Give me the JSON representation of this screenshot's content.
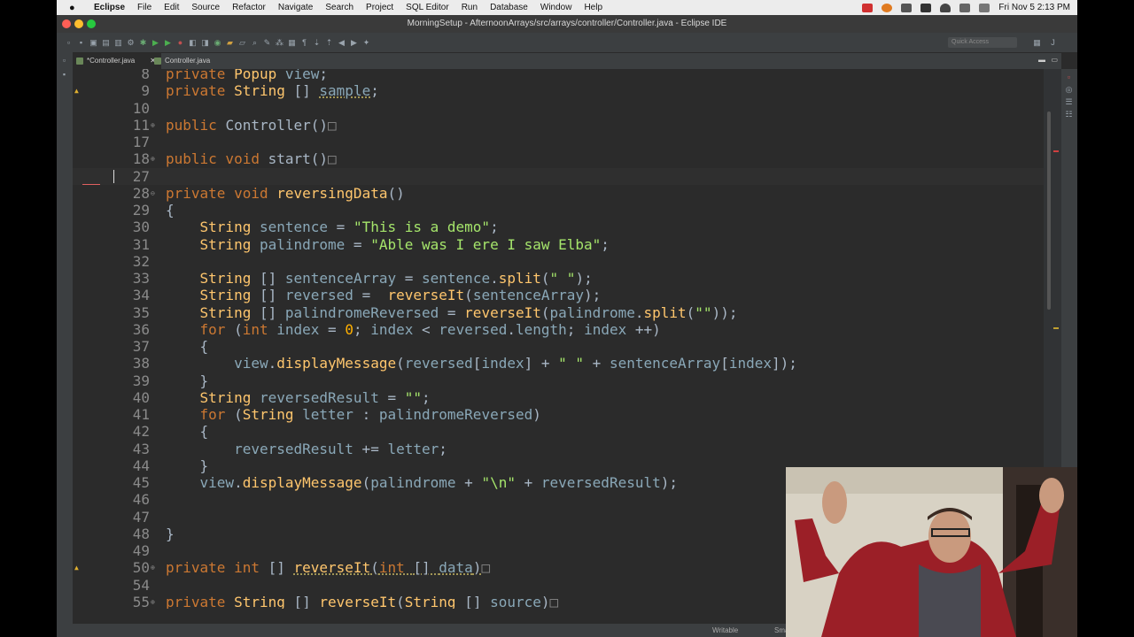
{
  "menubar": {
    "app": "Eclipse",
    "items": [
      "File",
      "Edit",
      "Source",
      "Refactor",
      "Navigate",
      "Search",
      "Project",
      "SQL Editor",
      "Run",
      "Database",
      "Window",
      "Help"
    ],
    "clock": "Fri Nov 5  2:13 PM"
  },
  "window": {
    "title": "MorningSetup - AfternoonArrays/src/arrays/controller/Controller.java - Eclipse IDE"
  },
  "toolbar": {
    "quick_access": "Quick Access"
  },
  "tabs": [
    {
      "label": "*Controller.java",
      "active": true,
      "close": "✕"
    },
    {
      "label": "Controller.java",
      "active": false
    }
  ],
  "editor": {
    "lines": [
      {
        "n": "8",
        "segs": [
          [
            "kw",
            "private "
          ],
          [
            "ty",
            "Popup "
          ],
          [
            "var",
            "view"
          ],
          [
            "p",
            ";"
          ]
        ]
      },
      {
        "n": "9",
        "segs": [
          [
            "kw",
            "private "
          ],
          [
            "ty",
            "String "
          ],
          [
            "p",
            "[] "
          ],
          [
            "warn",
            "sample"
          ],
          [
            "p",
            ";"
          ]
        ]
      },
      {
        "n": "10",
        "segs": []
      },
      {
        "n": "11",
        "fold": "⊕",
        "segs": [
          [
            "kw",
            "public "
          ],
          [
            "p",
            "Controller()"
          ],
          [
            "box",
            "□"
          ]
        ]
      },
      {
        "n": "17",
        "segs": []
      },
      {
        "n": "18",
        "fold": "⊕",
        "segs": [
          [
            "kw",
            "public void "
          ],
          [
            "p",
            "start()"
          ],
          [
            "box",
            "□"
          ]
        ]
      },
      {
        "n": "27",
        "segs": []
      },
      {
        "n": "28",
        "fold": "⊖",
        "segs": [
          [
            "kw",
            "private void "
          ],
          [
            "fn",
            "reversingData"
          ],
          [
            "p",
            "()"
          ]
        ]
      },
      {
        "n": "29",
        "segs": [
          [
            "p",
            "{"
          ]
        ]
      },
      {
        "n": "30",
        "segs": [
          [
            "p",
            "    "
          ],
          [
            "ty",
            "String "
          ],
          [
            "var",
            "sentence"
          ],
          [
            "p",
            " = "
          ],
          [
            "str",
            "\"This is a demo\""
          ],
          [
            "p",
            ";"
          ]
        ]
      },
      {
        "n": "31",
        "segs": [
          [
            "p",
            "    "
          ],
          [
            "ty",
            "String "
          ],
          [
            "var",
            "palindrome"
          ],
          [
            "p",
            " = "
          ],
          [
            "str",
            "\"Able was I ere I saw Elba\""
          ],
          [
            "p",
            ";"
          ]
        ]
      },
      {
        "n": "32",
        "segs": []
      },
      {
        "n": "33",
        "segs": [
          [
            "p",
            "    "
          ],
          [
            "ty",
            "String "
          ],
          [
            "p",
            "[] "
          ],
          [
            "var",
            "sentenceArray"
          ],
          [
            "p",
            " = "
          ],
          [
            "var",
            "sentence"
          ],
          [
            "p",
            "."
          ],
          [
            "fn",
            "split"
          ],
          [
            "p",
            "("
          ],
          [
            "str",
            "\" \""
          ],
          [
            "p",
            ");"
          ]
        ]
      },
      {
        "n": "34",
        "segs": [
          [
            "p",
            "    "
          ],
          [
            "ty",
            "String "
          ],
          [
            "p",
            "[] "
          ],
          [
            "var",
            "reversed"
          ],
          [
            "p",
            " =  "
          ],
          [
            "fn",
            "reverseIt"
          ],
          [
            "p",
            "("
          ],
          [
            "var",
            "sentenceArray"
          ],
          [
            "p",
            ");"
          ]
        ]
      },
      {
        "n": "35",
        "segs": [
          [
            "p",
            "    "
          ],
          [
            "ty",
            "String "
          ],
          [
            "p",
            "[] "
          ],
          [
            "var",
            "palindromeReversed"
          ],
          [
            "p",
            " = "
          ],
          [
            "fn",
            "reverseIt"
          ],
          [
            "p",
            "("
          ],
          [
            "var",
            "palindrome"
          ],
          [
            "p",
            "."
          ],
          [
            "fn",
            "split"
          ],
          [
            "p",
            "("
          ],
          [
            "str",
            "\"\""
          ],
          [
            "p",
            "));"
          ]
        ]
      },
      {
        "n": "36",
        "segs": [
          [
            "p",
            "    "
          ],
          [
            "kw",
            "for "
          ],
          [
            "p",
            "("
          ],
          [
            "kw",
            "int "
          ],
          [
            "var",
            "index"
          ],
          [
            "p",
            " = "
          ],
          [
            "num",
            "0"
          ],
          [
            "p",
            "; "
          ],
          [
            "var",
            "index"
          ],
          [
            "p",
            " < "
          ],
          [
            "var",
            "reversed"
          ],
          [
            "p",
            "."
          ],
          [
            "var",
            "length"
          ],
          [
            "p",
            "; "
          ],
          [
            "var",
            "index"
          ],
          [
            "p",
            " ++)"
          ]
        ]
      },
      {
        "n": "37",
        "segs": [
          [
            "p",
            "    {"
          ]
        ]
      },
      {
        "n": "38",
        "segs": [
          [
            "p",
            "        "
          ],
          [
            "var",
            "view"
          ],
          [
            "p",
            "."
          ],
          [
            "fn",
            "displayMessage"
          ],
          [
            "p",
            "("
          ],
          [
            "var",
            "reversed"
          ],
          [
            "p",
            "["
          ],
          [
            "var",
            "index"
          ],
          [
            "p",
            "] + "
          ],
          [
            "str",
            "\" \""
          ],
          [
            "p",
            " + "
          ],
          [
            "var",
            "sentenceArray"
          ],
          [
            "p",
            "["
          ],
          [
            "var",
            "index"
          ],
          [
            "p",
            "]);"
          ]
        ]
      },
      {
        "n": "39",
        "segs": [
          [
            "p",
            "    }"
          ]
        ]
      },
      {
        "n": "40",
        "segs": [
          [
            "p",
            "    "
          ],
          [
            "ty",
            "String "
          ],
          [
            "var",
            "reversedResult"
          ],
          [
            "p",
            " = "
          ],
          [
            "str",
            "\"\""
          ],
          [
            "p",
            ";"
          ]
        ]
      },
      {
        "n": "41",
        "segs": [
          [
            "p",
            "    "
          ],
          [
            "kw",
            "for "
          ],
          [
            "p",
            "("
          ],
          [
            "ty",
            "String "
          ],
          [
            "var",
            "letter"
          ],
          [
            "p",
            " : "
          ],
          [
            "var",
            "palindromeReversed"
          ],
          [
            "p",
            ")"
          ]
        ]
      },
      {
        "n": "42",
        "segs": [
          [
            "p",
            "    {"
          ]
        ]
      },
      {
        "n": "43",
        "segs": [
          [
            "p",
            "        "
          ],
          [
            "var",
            "reversedResult"
          ],
          [
            "p",
            " += "
          ],
          [
            "var",
            "letter"
          ],
          [
            "p",
            ";"
          ]
        ]
      },
      {
        "n": "44",
        "segs": [
          [
            "p",
            "    }"
          ]
        ]
      },
      {
        "n": "45",
        "segs": [
          [
            "p",
            "    "
          ],
          [
            "var",
            "view"
          ],
          [
            "p",
            "."
          ],
          [
            "fn",
            "displayMessage"
          ],
          [
            "p",
            "("
          ],
          [
            "var",
            "palindrome"
          ],
          [
            "p",
            " + "
          ],
          [
            "str",
            "\"\\n\""
          ],
          [
            "p",
            " + "
          ],
          [
            "var",
            "reversedResult"
          ],
          [
            "p",
            ");"
          ]
        ]
      },
      {
        "n": "46",
        "segs": []
      },
      {
        "n": "47",
        "segs": []
      },
      {
        "n": "48",
        "segs": [
          [
            "p",
            "}"
          ]
        ]
      },
      {
        "n": "49",
        "segs": []
      },
      {
        "n": "50",
        "fold": "⊕",
        "segs": [
          [
            "kw",
            "private "
          ],
          [
            "kw",
            "int "
          ],
          [
            "p",
            "[] "
          ],
          [
            "warnfn",
            "reverseIt"
          ],
          [
            "warnp",
            "("
          ],
          [
            "warnkw",
            "int "
          ],
          [
            "warnp",
            "[] "
          ],
          [
            "warnvar",
            "data"
          ],
          [
            "warnp",
            ")"
          ],
          [
            "box",
            "□"
          ]
        ]
      },
      {
        "n": "54",
        "segs": []
      },
      {
        "n": "55",
        "fold": "⊕",
        "segs": [
          [
            "kw",
            "private "
          ],
          [
            "ty",
            "String "
          ],
          [
            "p",
            "[] "
          ],
          [
            "fn",
            "reverseIt"
          ],
          [
            "p",
            "("
          ],
          [
            "ty",
            "String "
          ],
          [
            "p",
            "[] "
          ],
          [
            "var",
            "source"
          ],
          [
            "p",
            ")"
          ],
          [
            "box",
            "□"
          ]
        ]
      }
    ]
  },
  "status": {
    "writable": "Writable",
    "insert": "Sma"
  },
  "colors": {
    "keyword": "#cc7832",
    "type": "#ffc66d",
    "string": "#a5e56b",
    "number": "#ffb000",
    "variable": "#8aa8b8",
    "background": "#2b2b2b"
  }
}
